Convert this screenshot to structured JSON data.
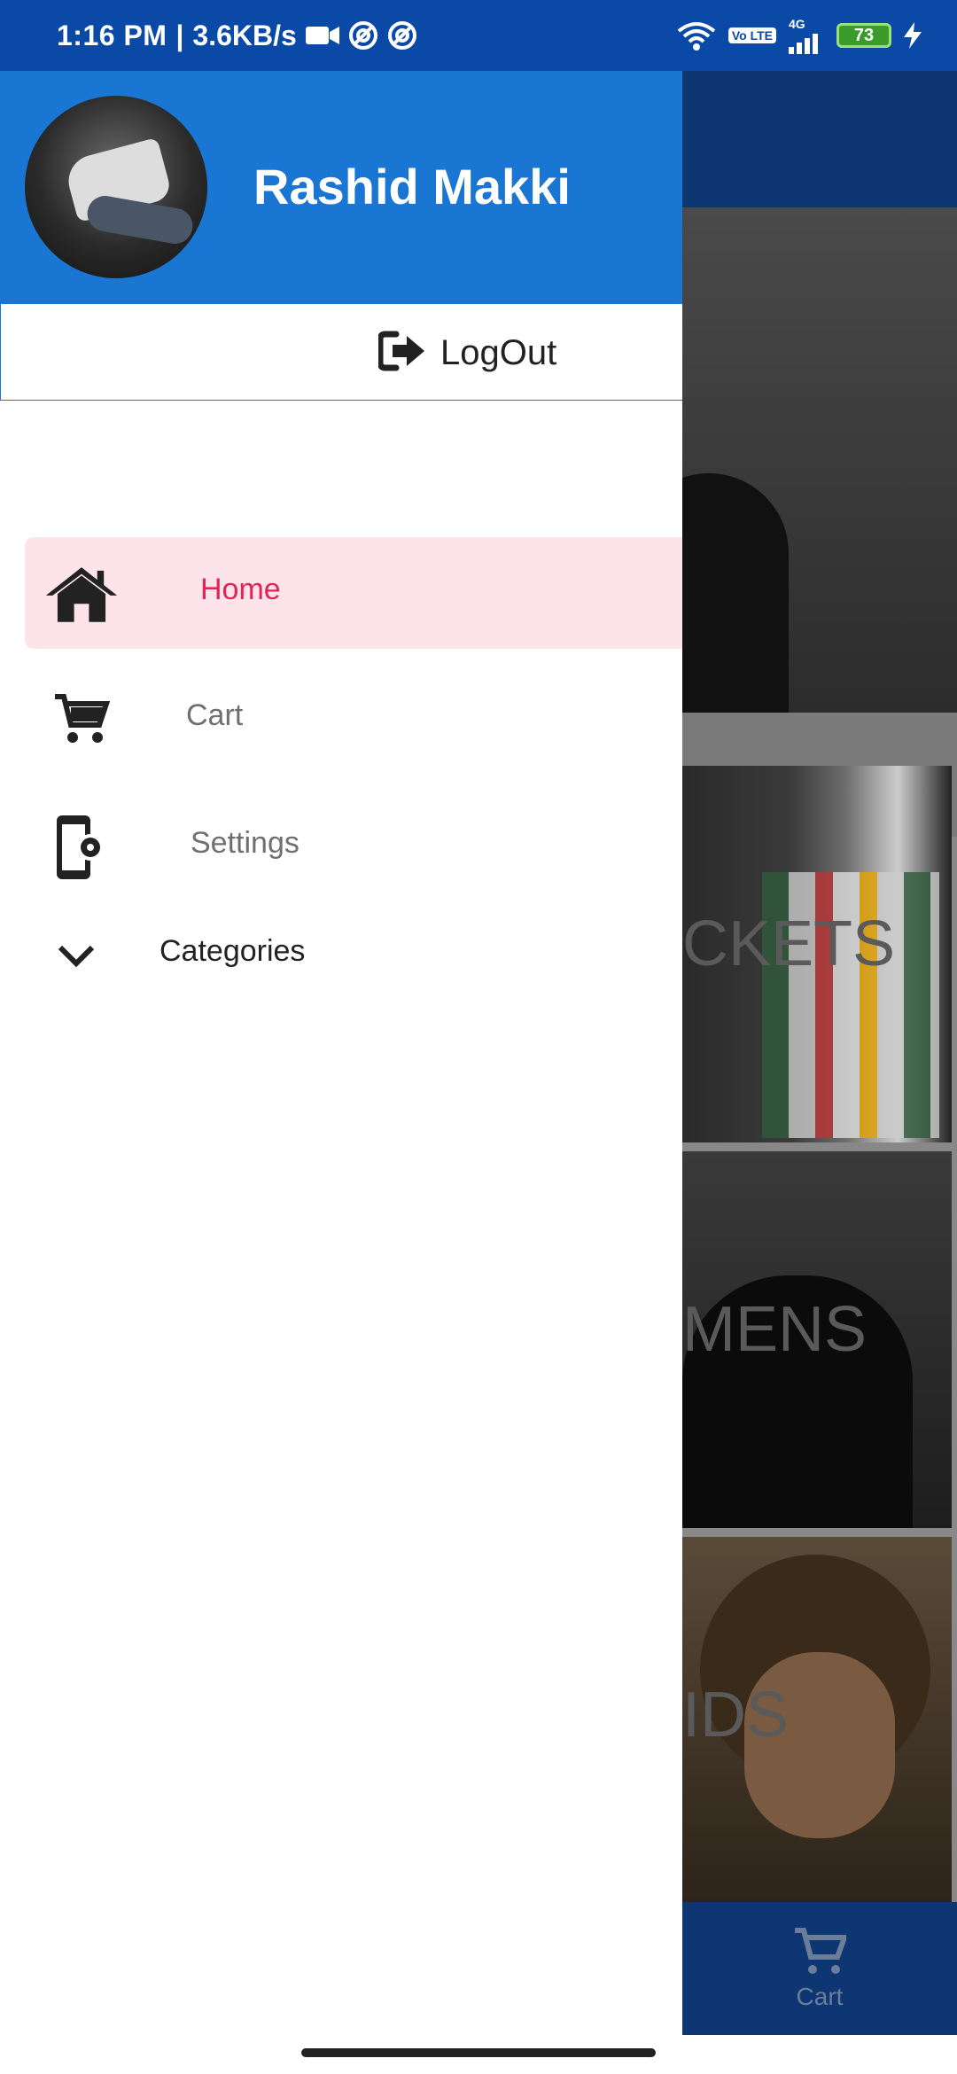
{
  "status_bar": {
    "time": "1:16 PM",
    "network_speed": "3.6KB/s",
    "volte_label": "Vo LTE",
    "network_type": "4G",
    "battery_level": "73"
  },
  "drawer": {
    "user_name": "Rashid Makki",
    "logout_label": "LogOut",
    "items": [
      {
        "label": "Home",
        "icon": "home-icon",
        "active": true
      },
      {
        "label": "Cart",
        "icon": "cart-icon",
        "active": false
      },
      {
        "label": "Settings",
        "icon": "phone-settings-icon",
        "active": false
      }
    ],
    "categories_label": "Categories"
  },
  "background_app": {
    "cards": [
      "CKETS",
      "MENS",
      "IDS"
    ],
    "bottom_nav_label": "Cart"
  },
  "colors": {
    "header_blue": "#1976d2",
    "status_bar": "#0a4aa6",
    "active_text": "#e0245e",
    "active_bg": "#fde4ea"
  }
}
